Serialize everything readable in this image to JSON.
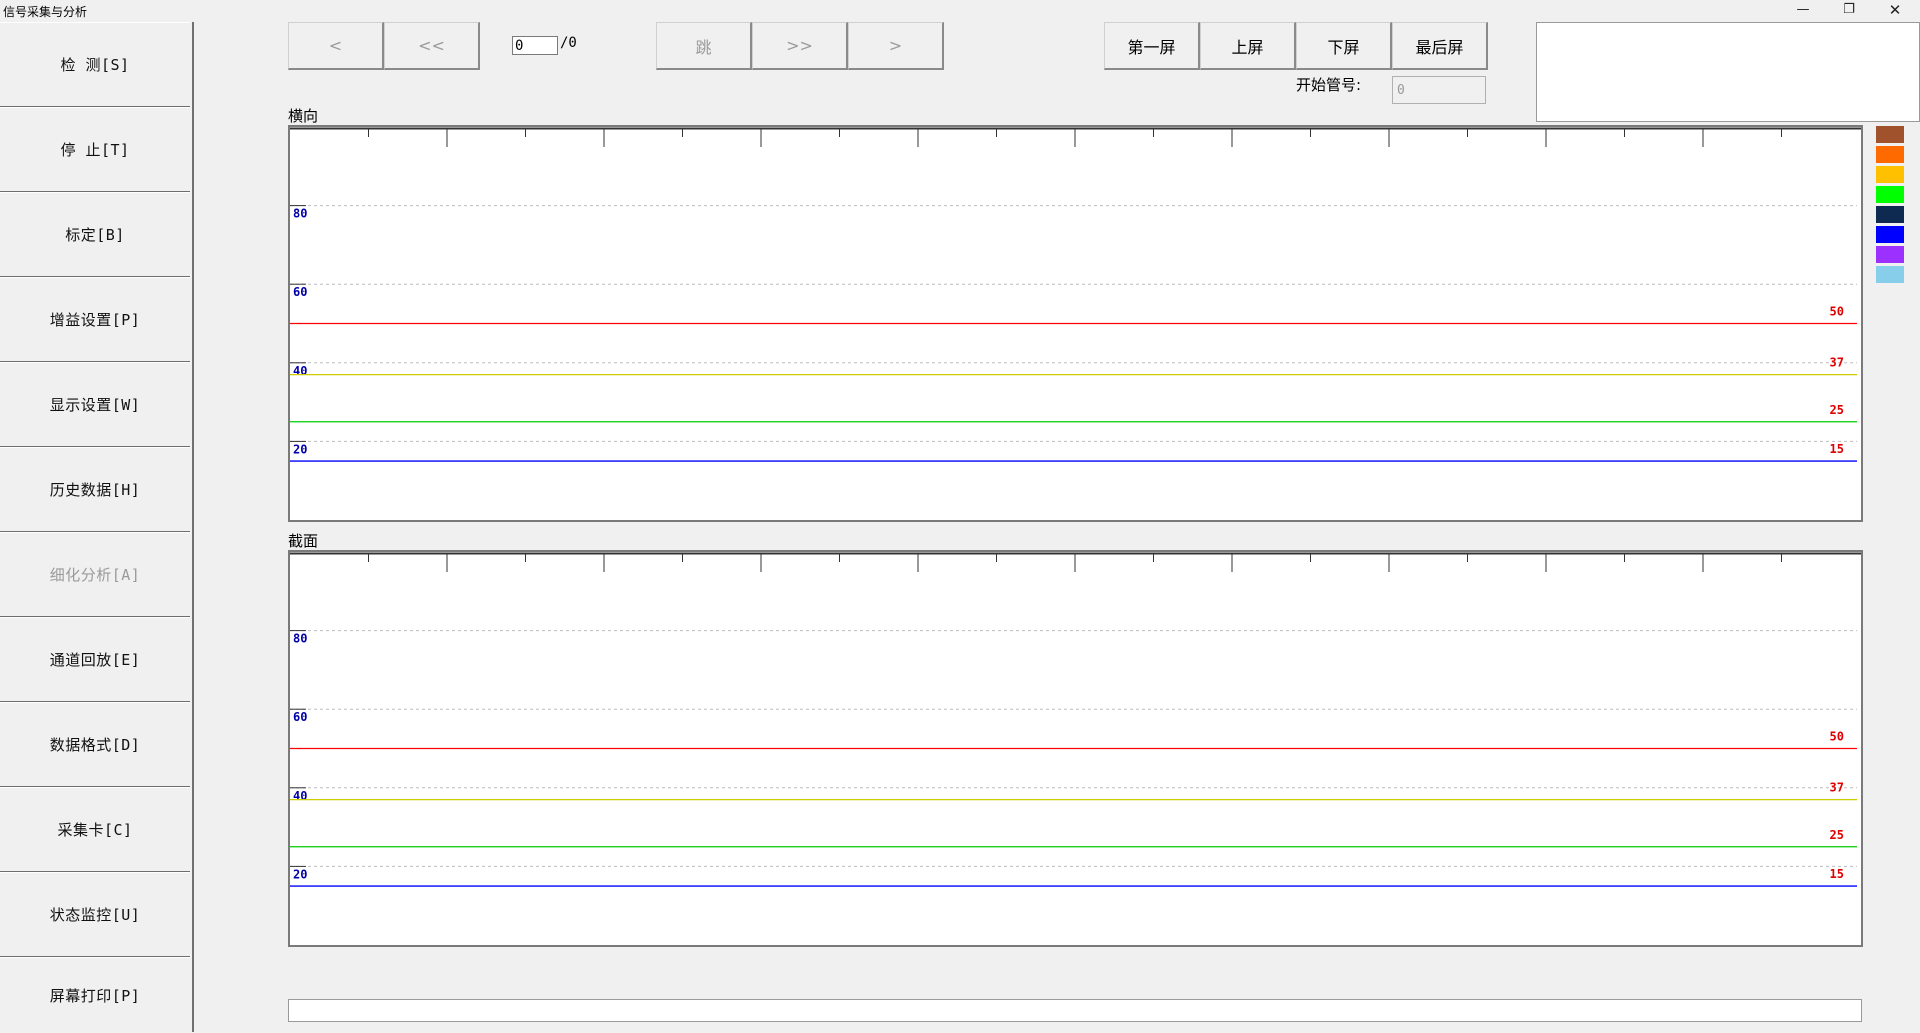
{
  "window": {
    "title": "信号采集与分析",
    "minimize_icon": "minimize-icon",
    "maximize_icon": "restore-icon",
    "close_icon": "close-icon"
  },
  "sidebar": {
    "items": [
      {
        "label": "检  测[S]",
        "enabled": true
      },
      {
        "label": "停 止[T]",
        "enabled": true
      },
      {
        "label": "标定[B]",
        "enabled": true
      },
      {
        "label": "增益设置[P]",
        "enabled": true
      },
      {
        "label": "显示设置[W]",
        "enabled": true
      },
      {
        "label": "历史数据[H]",
        "enabled": true
      },
      {
        "label": "细化分析[A]",
        "enabled": false
      },
      {
        "label": "通道回放[E]",
        "enabled": true
      },
      {
        "label": "数据格式[D]",
        "enabled": true
      },
      {
        "label": "采集卡[C]",
        "enabled": true
      },
      {
        "label": "状态监控[U]",
        "enabled": true
      },
      {
        "label": "屏幕打印[P]",
        "enabled": true
      }
    ]
  },
  "toolbar": {
    "prev": "<",
    "prev_fast": "<<",
    "page_value": "0",
    "page_total": "/0",
    "jump": "跳",
    "next_fast": ">>",
    "next": ">",
    "first_screen": "第一屏",
    "prev_screen": "上屏",
    "next_screen": "下屏",
    "last_screen": "最后屏",
    "start_pipe_label": "开始管号:",
    "start_pipe_value": "0"
  },
  "chart_data": [
    {
      "type": "line",
      "title": "横向",
      "ylim": [
        0,
        100
      ],
      "yticks": [
        "80",
        "60",
        "40",
        "20"
      ],
      "threshold_lines": [
        {
          "value": 50,
          "label": "50",
          "color": "#ff0000"
        },
        {
          "value": 37,
          "label": "37",
          "color": "#cccc00"
        },
        {
          "value": 25,
          "label": "25",
          "color": "#00cc00"
        },
        {
          "value": 15,
          "label": "15",
          "color": "#0000ff"
        }
      ],
      "series": []
    },
    {
      "type": "line",
      "title": "截面",
      "ylim": [
        0,
        100
      ],
      "yticks": [
        "80",
        "60",
        "40",
        "20"
      ],
      "threshold_lines": [
        {
          "value": 50,
          "label": "50",
          "color": "#ff0000"
        },
        {
          "value": 37,
          "label": "37",
          "color": "#cccc00"
        },
        {
          "value": 25,
          "label": "25",
          "color": "#00cc00"
        },
        {
          "value": 15,
          "label": "15",
          "color": "#0000ff"
        }
      ],
      "series": []
    }
  ],
  "legend_colors": [
    "#a0522d",
    "#ff6a00",
    "#ffc000",
    "#00ff00",
    "#0e2a50",
    "#0000ff",
    "#9b30ff",
    "#87ceeb"
  ],
  "status": {
    "text": ""
  }
}
